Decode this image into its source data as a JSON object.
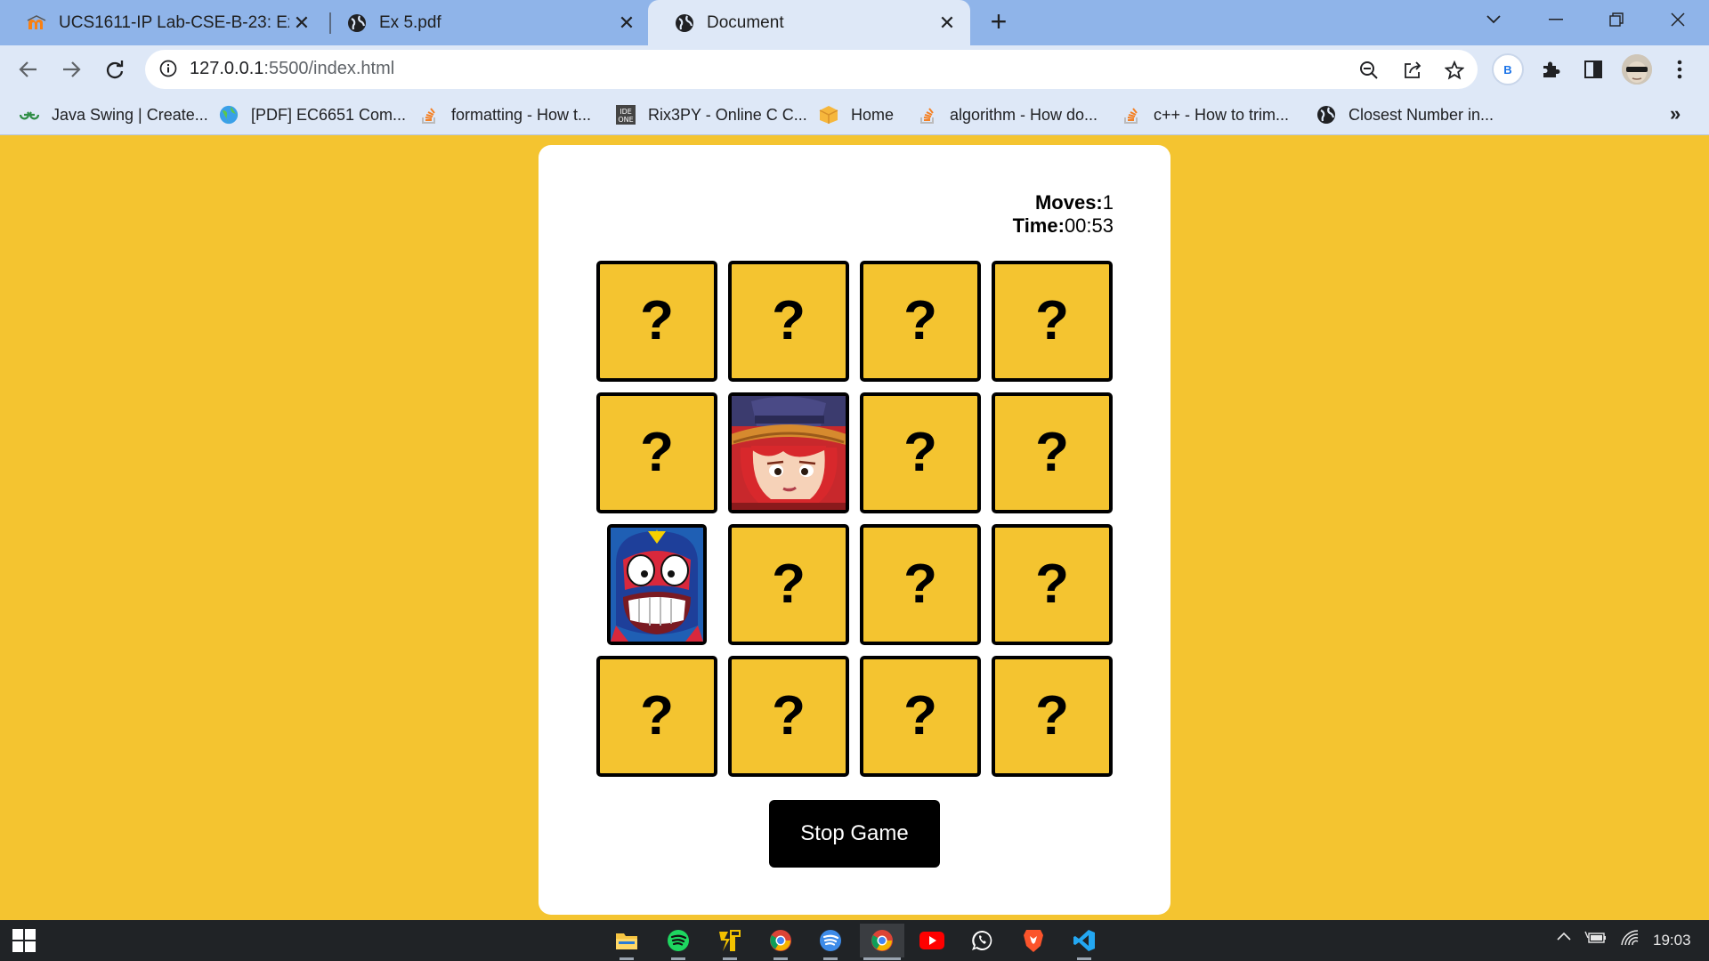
{
  "browser": {
    "tabs": [
      {
        "title": "UCS1611-IP Lab-CSE-B-23: Ex 4:",
        "icon": "moodle-icon",
        "active": false
      },
      {
        "title": "Ex 5.pdf",
        "icon": "globe-icon",
        "active": false
      },
      {
        "title": "Document",
        "icon": "globe-icon",
        "active": true
      }
    ],
    "new_tab_label": "+",
    "url_host": "127.0.0.1",
    "url_path": ":5500/index.html",
    "profile_initial": "B",
    "bookmarks": [
      {
        "label": "Java Swing | Create...",
        "icon": "gfg-icon"
      },
      {
        "label": "[PDF] EC6651 Com...",
        "icon": "globe-color-icon"
      },
      {
        "label": "formatting - How t...",
        "icon": "stackoverflow-icon"
      },
      {
        "label": "Rix3PY - Online C C...",
        "icon": "ideone-icon"
      },
      {
        "label": "Home",
        "icon": "box-icon"
      },
      {
        "label": "algorithm - How do...",
        "icon": "stackoverflow-icon"
      },
      {
        "label": "c++ - How to trim...",
        "icon": "stackoverflow-icon"
      },
      {
        "label": "Closest Number in...",
        "icon": "globe-icon"
      }
    ],
    "bookmarks_overflow": "»"
  },
  "game": {
    "moves_label": "Moves:",
    "moves_value": "1",
    "time_label": "Time:",
    "time_value": "00:53",
    "hidden_symbol": "?",
    "tiles": [
      "hidden",
      "hidden",
      "hidden",
      "hidden",
      "hidden",
      "colt",
      "hidden",
      "hidden",
      "elprimo",
      "hidden",
      "hidden",
      "hidden",
      "hidden",
      "hidden",
      "hidden",
      "hidden"
    ],
    "stop_button_label": "Stop Game",
    "colors": {
      "background": "#f4c430",
      "card": "#ffffff",
      "tile_border": "#000000",
      "button": "#000000"
    }
  },
  "taskbar": {
    "apps": [
      "file-explorer-icon",
      "spotify-icon",
      "app-icon",
      "chrome-icon",
      "spotify-alt-icon",
      "chrome-active-icon",
      "youtube-icon",
      "whatsapp-icon",
      "brave-icon",
      "vscode-icon"
    ],
    "clock": "19:03"
  }
}
